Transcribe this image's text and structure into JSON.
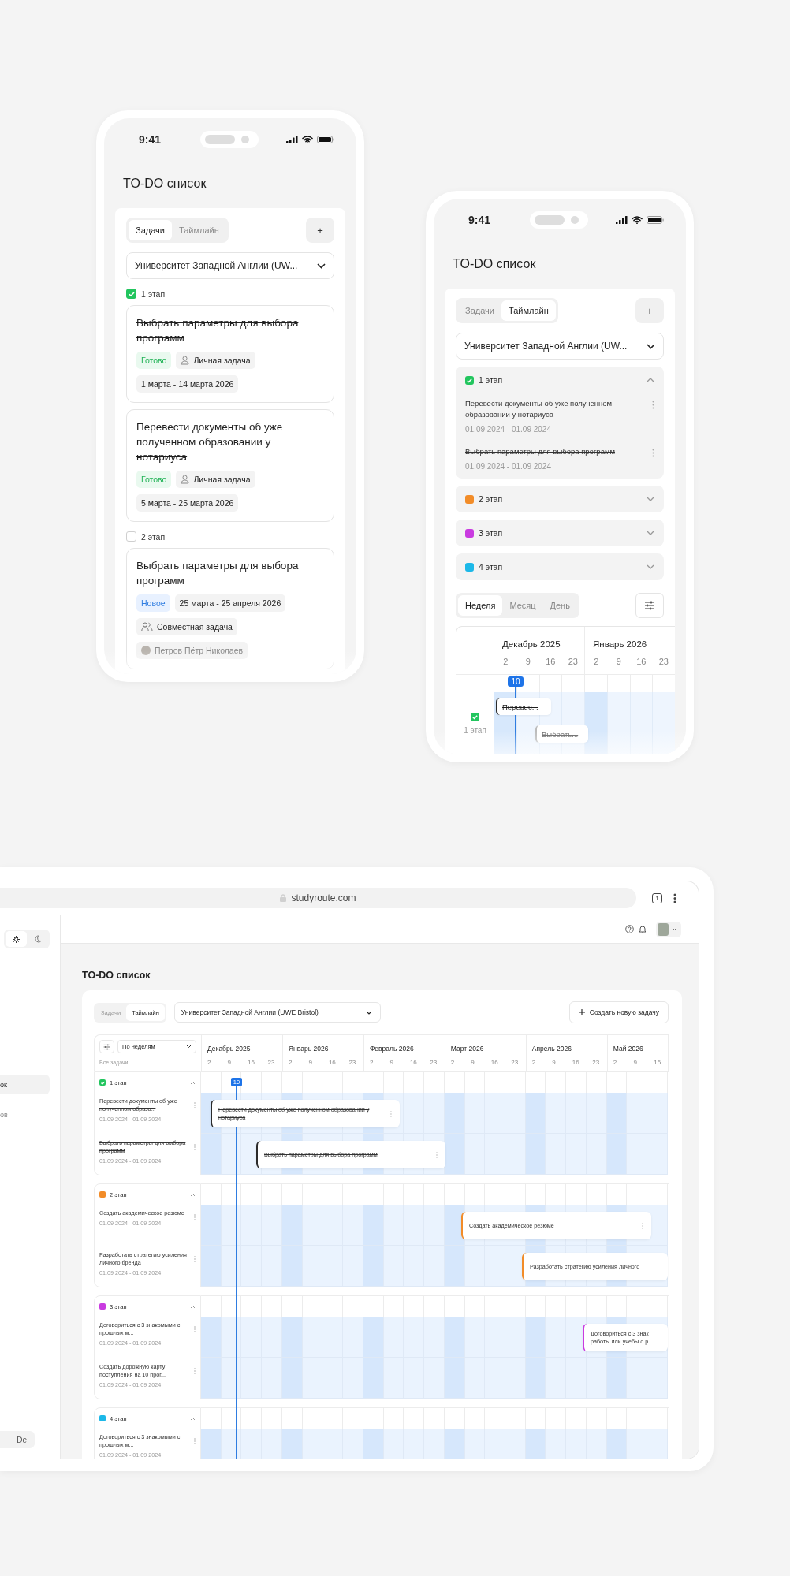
{
  "phones": [
    {
      "kind": "tasks",
      "time": "9:41",
      "title": "TO-DO список",
      "tabs": [
        {
          "label": "Задачи",
          "selected": true
        },
        {
          "label": "Таймлайн",
          "selected": false
        }
      ],
      "add_button": "+",
      "university": "Университет Западной Англии (UW...",
      "stages": [
        {
          "label": "1 этап",
          "checked": true,
          "tasks": [
            {
              "title": "Выбрать параметры для выбора программ",
              "done": true,
              "chip_rows": [
                [
                  {
                    "kind": "done",
                    "label": "Готово"
                  },
                  {
                    "kind": "personal",
                    "label": "Личная задача"
                  }
                ],
                [
                  {
                    "kind": "date",
                    "label": "1 марта - 14 марта 2026"
                  }
                ]
              ]
            },
            {
              "title": "Перевести документы об уже полученном образовании у нотариуса",
              "done": true,
              "chip_rows": [
                [
                  {
                    "kind": "done",
                    "label": "Готово"
                  },
                  {
                    "kind": "personal",
                    "label": "Личная задача"
                  }
                ],
                [
                  {
                    "kind": "date",
                    "label": "5 марта - 25 марта 2026"
                  }
                ]
              ]
            }
          ]
        },
        {
          "label": "2 этап",
          "checked": false,
          "tasks": [
            {
              "title": "Выбрать параметры для выбора программ",
              "done": false,
              "chip_rows": [
                [
                  {
                    "kind": "new",
                    "label": "Новое"
                  },
                  {
                    "kind": "date",
                    "label": "25 марта - 25 апреля 2026"
                  }
                ],
                [
                  {
                    "kind": "shared",
                    "label": "Совместная задача"
                  }
                ],
                [
                  {
                    "kind": "person",
                    "label": "Петров Пётр Николаев"
                  }
                ]
              ]
            }
          ]
        }
      ]
    },
    {
      "kind": "timeline",
      "time": "9:41",
      "title": "TO-DO список",
      "tabs": [
        {
          "label": "Задачи",
          "selected": false
        },
        {
          "label": "Таймлайн",
          "selected": true
        }
      ],
      "add_button": "+",
      "university": "Университет Западной Англии (UW...",
      "stages": [
        {
          "label": "1 этап",
          "color": "#22c55e",
          "checked": true,
          "expanded": true,
          "tasks": [
            {
              "title": "Перевести документы об уже полученном образовании у нотариуса",
              "done": true,
              "dates": "01.09 2024 - 01.09 2024"
            },
            {
              "title": "Выбрать параметры для выбора программ",
              "done": true,
              "dates": "01.09 2024 - 01.09 2024"
            }
          ]
        },
        {
          "label": "2 этап",
          "color": "#f28c28",
          "checked": false,
          "expanded": false
        },
        {
          "label": "3 этап",
          "color": "#c93be0",
          "checked": false,
          "expanded": false
        },
        {
          "label": "4 этап",
          "color": "#1cb8e8",
          "checked": false,
          "expanded": false
        }
      ],
      "views": [
        {
          "label": "Неделя",
          "selected": true
        },
        {
          "label": "Месяц",
          "selected": false
        },
        {
          "label": "День",
          "selected": false
        }
      ],
      "gantt": {
        "months": [
          {
            "label": "Декабрь 2025",
            "weeks": [
              "2",
              "9",
              "16",
              "23"
            ]
          },
          {
            "label": "Январь 2026",
            "weeks": [
              "2",
              "9",
              "16",
              "23"
            ]
          }
        ],
        "today": "10",
        "rows": [
          {
            "label": "1 этап",
            "checked": true,
            "bars": [
              {
                "label": "Перевес...",
                "done": true
              },
              {
                "label": "Выбрать...",
                "done": true
              }
            ]
          }
        ]
      }
    }
  ],
  "desktop": {
    "url": "studyroute.com",
    "tab_count": "1",
    "theme": [
      {
        "kind": "light",
        "selected": true
      },
      {
        "kind": "dark",
        "selected": false
      }
    ],
    "sidebar": [
      {
        "label": "ок",
        "selected": true
      },
      {
        "label": "ов",
        "selected": false
      }
    ],
    "language": "De",
    "title": "TO-DO список",
    "tabs": [
      {
        "label": "Задачи",
        "selected": false
      },
      {
        "label": "Таймлайн",
        "selected": true
      }
    ],
    "university": "Университет Западной Англии (UWE Bristol)",
    "create_button": "Создать новую задачу",
    "group_by": "По неделям",
    "filter_label": "Все задачи",
    "months": [
      {
        "label": "Декабрь 2025",
        "weeks": [
          "2",
          "9",
          "16",
          "23"
        ]
      },
      {
        "label": "Январь 2026",
        "weeks": [
          "2",
          "9",
          "16",
          "23"
        ]
      },
      {
        "label": "Февраль 2026",
        "weeks": [
          "2",
          "9",
          "16",
          "23"
        ]
      },
      {
        "label": "Март 2026",
        "weeks": [
          "2",
          "9",
          "16",
          "23"
        ]
      },
      {
        "label": "Апрель 2026",
        "weeks": [
          "2",
          "9",
          "16",
          "23"
        ]
      },
      {
        "label": "Май 2026",
        "weeks": [
          "2",
          "9",
          "16"
        ]
      }
    ],
    "today": "10",
    "stages": [
      {
        "label": "1 этап",
        "color": "#22c55e",
        "checked": true,
        "expanded": true,
        "tasks": [
          {
            "title": "Перевести документы об уже полученном образо...",
            "dates": "01.09 2024 - 01.09 2024",
            "done": true,
            "bar": "Перевести документы об уже полученном образовании у нотариуса"
          },
          {
            "title": "Выбрать параметры для выбора программ",
            "dates": "01.09 2024 - 01.09 2024",
            "done": true,
            "bar": "Выбрать параметры для выбора программ"
          }
        ]
      },
      {
        "label": "2 этап",
        "color": "#f28c28",
        "checked": false,
        "expanded": true,
        "tasks": [
          {
            "title": "Создать академическое резюме",
            "dates": "01.09 2024 - 01.09 2024",
            "done": false,
            "bar": "Создать академическое резюме"
          },
          {
            "title": "Разработать стратегию усиления личного бренда",
            "dates": "01.09 2024 - 01.09 2024",
            "done": false,
            "bar": "Разработать стратегию усиления личного"
          }
        ]
      },
      {
        "label": "3 этап",
        "color": "#c93be0",
        "checked": false,
        "expanded": true,
        "tasks": [
          {
            "title": "Договориться с 3 знакомыми с прошлых м...",
            "dates": "01.09 2024 - 01.09 2024",
            "done": false,
            "bar": "Договориться с 3 знак\nработы или учебы о р"
          },
          {
            "title": "Создать дорожную карту поступления на 10 прог...",
            "dates": "01.09 2024 - 01.09 2024",
            "done": false
          }
        ]
      },
      {
        "label": "4 этап",
        "color": "#1cb8e8",
        "checked": false,
        "expanded": true,
        "tasks": [
          {
            "title": "Договориться с 3 знакомыми с прошлых м...",
            "dates": "01.09 2024 - 01.09 2024",
            "done": false
          }
        ]
      }
    ]
  }
}
